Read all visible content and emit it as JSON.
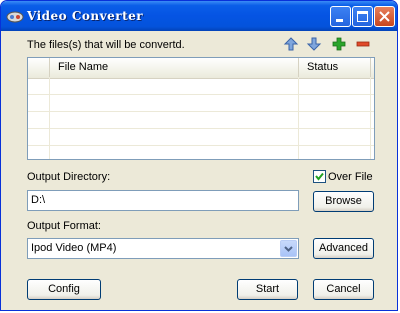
{
  "window": {
    "title": "Video Converter"
  },
  "files": {
    "label": "The files(s) that will be convertd.",
    "columns": [
      "File Name",
      "Status"
    ],
    "rows": [],
    "toolbar_icons": [
      "up-arrow-icon",
      "down-arrow-icon",
      "plus-icon",
      "minus-icon"
    ]
  },
  "output_directory": {
    "label": "Output Directory:",
    "value": "D:\\",
    "browse_label": "Browse",
    "overwrite_label": "Over File",
    "overwrite_checked": true
  },
  "output_format": {
    "label": "Output Format:",
    "selected": "Ipod Video (MP4)",
    "advanced_label": "Advanced"
  },
  "buttons": {
    "config": "Config",
    "start": "Start",
    "cancel": "Cancel"
  },
  "colors": {
    "titlebar": "#0554e3",
    "face": "#ece9d8",
    "border": "#7f9db9",
    "add": "#2aa52a",
    "remove": "#e04a2a"
  }
}
